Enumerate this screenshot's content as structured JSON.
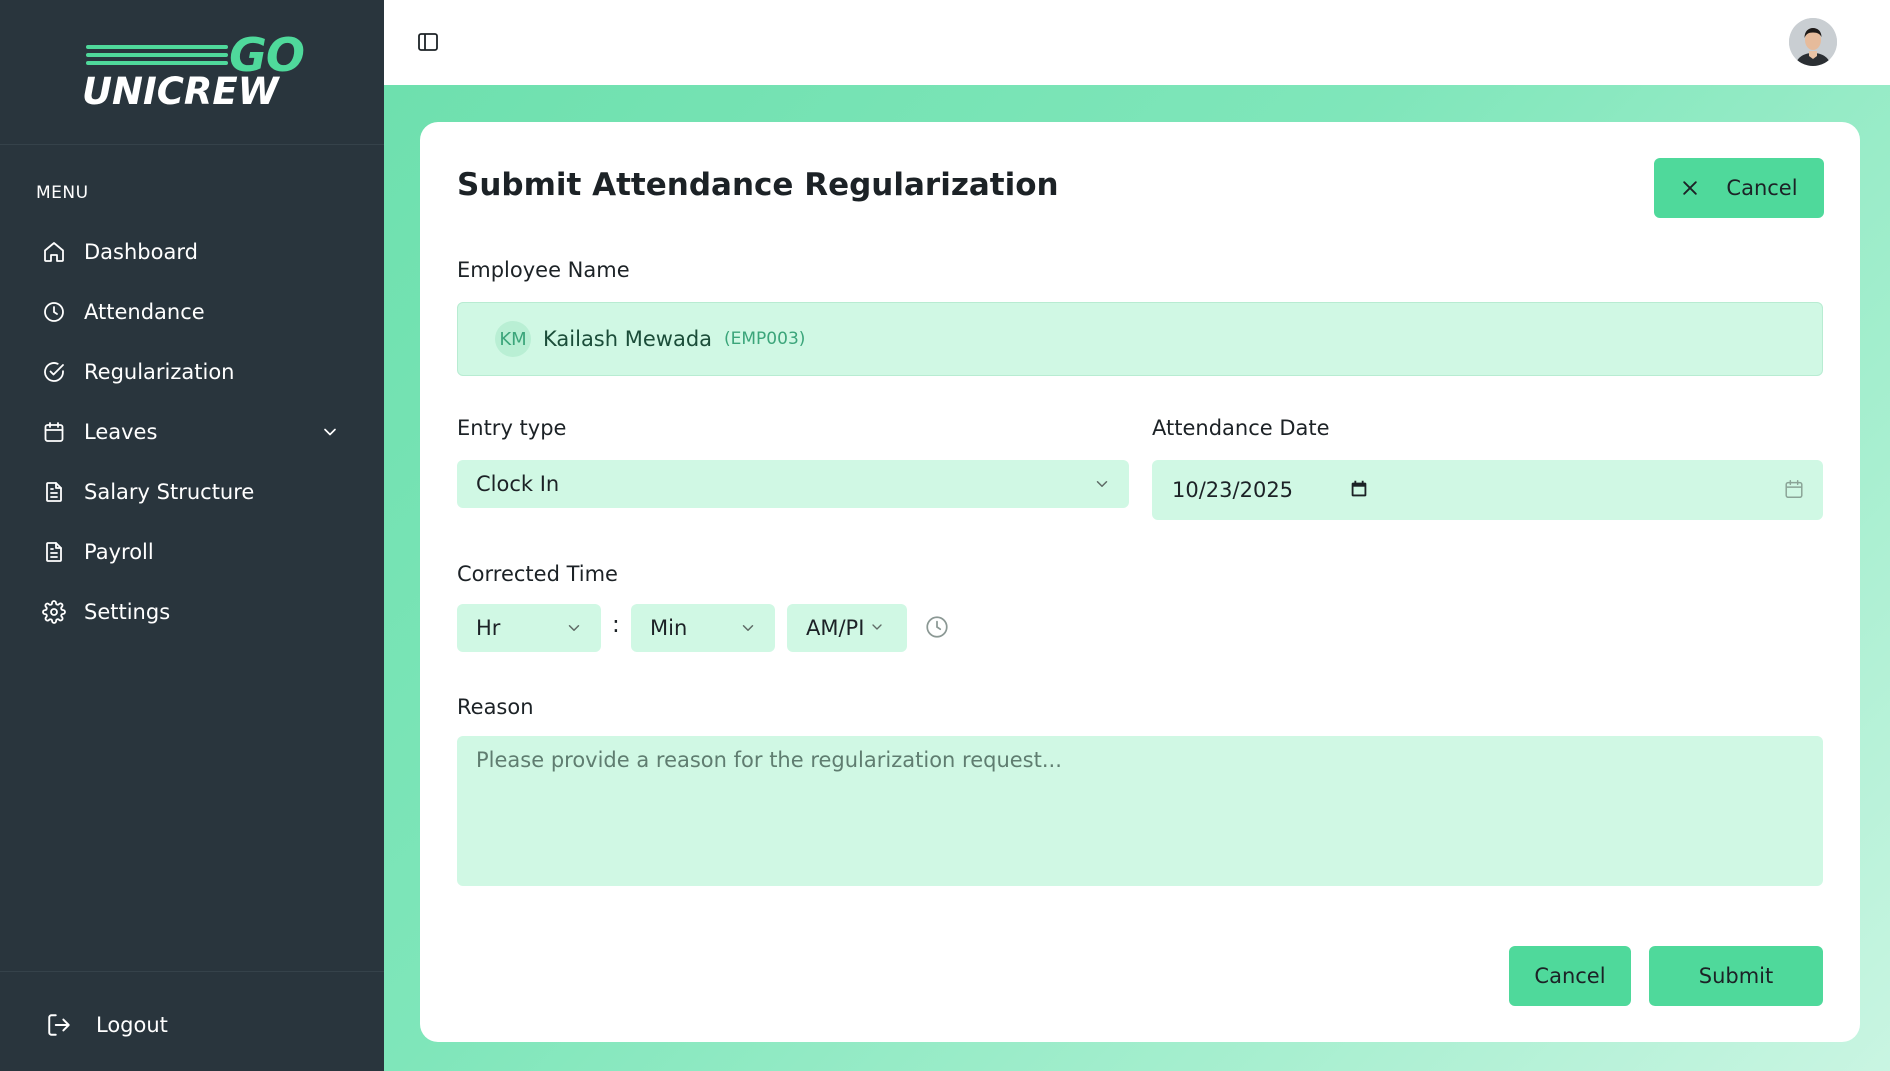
{
  "brand": {
    "logo_top": "GO",
    "logo_bottom": "UNICREW",
    "accent_color": "#4fd99b",
    "sidebar_color": "#29353d"
  },
  "sidebar": {
    "menu_title": "MENU",
    "items": [
      {
        "label": "Dashboard",
        "icon": "home-icon"
      },
      {
        "label": "Attendance",
        "icon": "clock-icon"
      },
      {
        "label": "Regularization",
        "icon": "check-circle-icon"
      },
      {
        "label": "Leaves",
        "icon": "calendar-icon",
        "has_submenu": true
      },
      {
        "label": "Salary Structure",
        "icon": "document-icon"
      },
      {
        "label": "Payroll",
        "icon": "document-icon"
      },
      {
        "label": "Settings",
        "icon": "gear-icon"
      }
    ],
    "logout_label": "Logout"
  },
  "header": {
    "toggle_icon": "sidebar-toggle-icon",
    "avatar_icon": "user-avatar"
  },
  "form": {
    "title": "Submit Attendance Regularization",
    "cancel_top_label": "Cancel",
    "employee_label": "Employee Name",
    "employee": {
      "initials": "KM",
      "name": "Kailash Mewada",
      "code": "(EMP003)"
    },
    "entry_type_label": "Entry type",
    "entry_type_value": "Clock In",
    "attendance_date_label": "Attendance Date",
    "attendance_date_value": "10/23/2025",
    "corrected_time_label": "Corrected Time",
    "hour_value": "Hr",
    "minute_value": "Min",
    "ampm_value": "AM/PI",
    "time_separator": ":",
    "reason_label": "Reason",
    "reason_placeholder": "Please provide a reason for the regularization request...",
    "cancel_label": "Cancel",
    "submit_label": "Submit"
  }
}
